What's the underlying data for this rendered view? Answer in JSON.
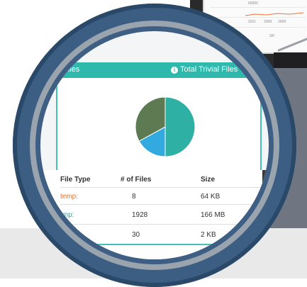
{
  "panel": {
    "header_left": "Files",
    "header_right": "Total Trivial Files"
  },
  "chart_data": {
    "type": "pie",
    "series": [
      {
        "values": [
          0.5,
          0.17,
          0.33
        ]
      }
    ],
    "colors": [
      "#2fb0a5",
      "#33aadf",
      "#5e7a52"
    ]
  },
  "table": {
    "headers": [
      "File Type",
      "# of Files",
      "Size"
    ],
    "rows": [
      {
        "type": "temp:",
        "count": "8",
        "size": "64 KB"
      },
      {
        "type": "tmp:",
        "count": "1928",
        "size": "166 MB"
      },
      {
        "type": "",
        "count": "30",
        "size": "2 KB"
      }
    ]
  },
  "background_chart": {
    "y_label": "60000",
    "x_ticks": [
      "2011",
      "2008",
      "2009"
    ],
    "x_label": "SR"
  }
}
